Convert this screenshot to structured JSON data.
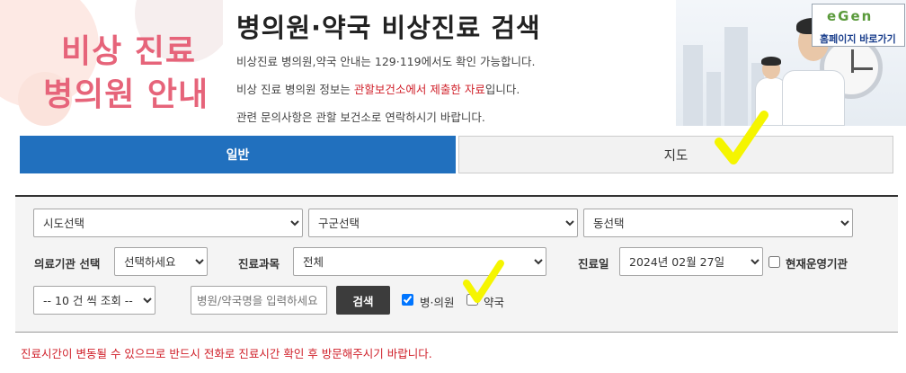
{
  "header": {
    "brand_line1": "비상 진료",
    "brand_line2": "병의원 안내",
    "title": "병의원·약국 비상진료 검색",
    "info1": "비상진료 병의원,약국 안내는 129·119에서도 확인 가능합니다.",
    "info2_pre": "비상 진료 병의원 정보는 ",
    "info2_red": "관할보건소에서 제출한 자료",
    "info2_post": "입니다.",
    "info3": "관련 문의사항은 관할 보건소로 연락하시기 바랍니다.",
    "home_logo": "eGen",
    "home_button": "홈페이지 바로가기"
  },
  "tabs": {
    "general": "일반",
    "map": "지도"
  },
  "search": {
    "sido": "시도선택",
    "gugun": "구군선택",
    "dong": "동선택",
    "institution_label": "의료기관 선택",
    "institution_value": "선택하세요",
    "department_label": "진료과목",
    "department_value": "전체",
    "date_label": "진료일",
    "date_value": "2024년 02월 27일",
    "operating_label": "현재운영기관",
    "page_size": "-- 10 건 씩 조회 --",
    "name_placeholder": "병원/약국명을 입력하세요",
    "search_button": "검색",
    "hospital_label": "병·의원",
    "pharmacy_label": "약국",
    "hospital_checked": true,
    "pharmacy_checked": false
  },
  "notice": "진료시간이 변동될 수 있으므로 반드시 전화로 진료시간 확인 후 방문해주시기 바랍니다.",
  "colors": {
    "tab_active": "#2170be",
    "brand_pink": "#e6647a",
    "highlight_red": "#d0202a",
    "annotation_yellow": "#f5f500"
  }
}
